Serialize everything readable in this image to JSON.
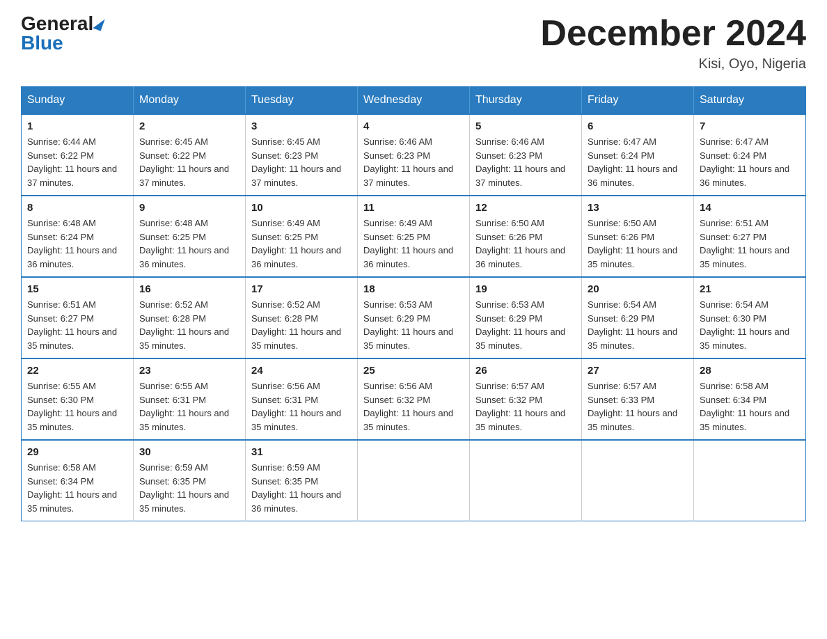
{
  "logo": {
    "general": "General",
    "blue": "Blue",
    "triangle": "▶"
  },
  "title": "December 2024",
  "subtitle": "Kisi, Oyo, Nigeria",
  "headers": [
    "Sunday",
    "Monday",
    "Tuesday",
    "Wednesday",
    "Thursday",
    "Friday",
    "Saturday"
  ],
  "weeks": [
    [
      {
        "day": "1",
        "sunrise": "6:44 AM",
        "sunset": "6:22 PM",
        "daylight": "11 hours and 37 minutes."
      },
      {
        "day": "2",
        "sunrise": "6:45 AM",
        "sunset": "6:22 PM",
        "daylight": "11 hours and 37 minutes."
      },
      {
        "day": "3",
        "sunrise": "6:45 AM",
        "sunset": "6:23 PM",
        "daylight": "11 hours and 37 minutes."
      },
      {
        "day": "4",
        "sunrise": "6:46 AM",
        "sunset": "6:23 PM",
        "daylight": "11 hours and 37 minutes."
      },
      {
        "day": "5",
        "sunrise": "6:46 AM",
        "sunset": "6:23 PM",
        "daylight": "11 hours and 37 minutes."
      },
      {
        "day": "6",
        "sunrise": "6:47 AM",
        "sunset": "6:24 PM",
        "daylight": "11 hours and 36 minutes."
      },
      {
        "day": "7",
        "sunrise": "6:47 AM",
        "sunset": "6:24 PM",
        "daylight": "11 hours and 36 minutes."
      }
    ],
    [
      {
        "day": "8",
        "sunrise": "6:48 AM",
        "sunset": "6:24 PM",
        "daylight": "11 hours and 36 minutes."
      },
      {
        "day": "9",
        "sunrise": "6:48 AM",
        "sunset": "6:25 PM",
        "daylight": "11 hours and 36 minutes."
      },
      {
        "day": "10",
        "sunrise": "6:49 AM",
        "sunset": "6:25 PM",
        "daylight": "11 hours and 36 minutes."
      },
      {
        "day": "11",
        "sunrise": "6:49 AM",
        "sunset": "6:25 PM",
        "daylight": "11 hours and 36 minutes."
      },
      {
        "day": "12",
        "sunrise": "6:50 AM",
        "sunset": "6:26 PM",
        "daylight": "11 hours and 36 minutes."
      },
      {
        "day": "13",
        "sunrise": "6:50 AM",
        "sunset": "6:26 PM",
        "daylight": "11 hours and 35 minutes."
      },
      {
        "day": "14",
        "sunrise": "6:51 AM",
        "sunset": "6:27 PM",
        "daylight": "11 hours and 35 minutes."
      }
    ],
    [
      {
        "day": "15",
        "sunrise": "6:51 AM",
        "sunset": "6:27 PM",
        "daylight": "11 hours and 35 minutes."
      },
      {
        "day": "16",
        "sunrise": "6:52 AM",
        "sunset": "6:28 PM",
        "daylight": "11 hours and 35 minutes."
      },
      {
        "day": "17",
        "sunrise": "6:52 AM",
        "sunset": "6:28 PM",
        "daylight": "11 hours and 35 minutes."
      },
      {
        "day": "18",
        "sunrise": "6:53 AM",
        "sunset": "6:29 PM",
        "daylight": "11 hours and 35 minutes."
      },
      {
        "day": "19",
        "sunrise": "6:53 AM",
        "sunset": "6:29 PM",
        "daylight": "11 hours and 35 minutes."
      },
      {
        "day": "20",
        "sunrise": "6:54 AM",
        "sunset": "6:29 PM",
        "daylight": "11 hours and 35 minutes."
      },
      {
        "day": "21",
        "sunrise": "6:54 AM",
        "sunset": "6:30 PM",
        "daylight": "11 hours and 35 minutes."
      }
    ],
    [
      {
        "day": "22",
        "sunrise": "6:55 AM",
        "sunset": "6:30 PM",
        "daylight": "11 hours and 35 minutes."
      },
      {
        "day": "23",
        "sunrise": "6:55 AM",
        "sunset": "6:31 PM",
        "daylight": "11 hours and 35 minutes."
      },
      {
        "day": "24",
        "sunrise": "6:56 AM",
        "sunset": "6:31 PM",
        "daylight": "11 hours and 35 minutes."
      },
      {
        "day": "25",
        "sunrise": "6:56 AM",
        "sunset": "6:32 PM",
        "daylight": "11 hours and 35 minutes."
      },
      {
        "day": "26",
        "sunrise": "6:57 AM",
        "sunset": "6:32 PM",
        "daylight": "11 hours and 35 minutes."
      },
      {
        "day": "27",
        "sunrise": "6:57 AM",
        "sunset": "6:33 PM",
        "daylight": "11 hours and 35 minutes."
      },
      {
        "day": "28",
        "sunrise": "6:58 AM",
        "sunset": "6:34 PM",
        "daylight": "11 hours and 35 minutes."
      }
    ],
    [
      {
        "day": "29",
        "sunrise": "6:58 AM",
        "sunset": "6:34 PM",
        "daylight": "11 hours and 35 minutes."
      },
      {
        "day": "30",
        "sunrise": "6:59 AM",
        "sunset": "6:35 PM",
        "daylight": "11 hours and 35 minutes."
      },
      {
        "day": "31",
        "sunrise": "6:59 AM",
        "sunset": "6:35 PM",
        "daylight": "11 hours and 36 minutes."
      },
      null,
      null,
      null,
      null
    ]
  ]
}
